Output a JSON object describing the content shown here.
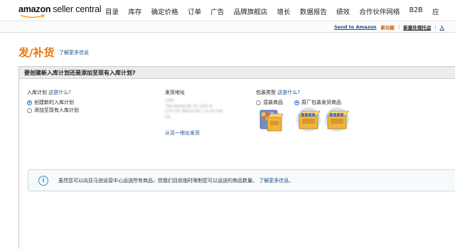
{
  "header": {
    "logo_word1": "amazon",
    "logo_word2": "seller central",
    "nav": [
      "目录",
      "库存",
      "确定价格",
      "订单",
      "广告",
      "品牌旗舰店",
      "增长",
      "数据报告",
      "绩效",
      "合作伙伴网络",
      "B2B",
      "应"
    ]
  },
  "subbar": {
    "send_to_amazon": "Send to Amazon",
    "help": "新功能",
    "separator": "|",
    "new_shipment": "新建处理托运",
    "trailing": "入"
  },
  "page": {
    "title": "发/补货",
    "learn_more": "了解更多信息"
  },
  "panel": {
    "question": "要创建新入库计划还是添加至现有入库计划?",
    "plan": {
      "label": "入库计划",
      "what": "这是什么?",
      "options": [
        {
          "label": "创建新的入库计划",
          "selected": true
        },
        {
          "label": "添加至现有入库计划",
          "selected": false
        }
      ]
    },
    "address": {
      "label": "发货地址",
      "lines": [
        "CHN",
        "789 NOVALEE ST UNIT B",
        "CITY OF INDUSTRY, CA 91748",
        "US"
      ],
      "ship_from_other": "从另一地址发货"
    },
    "packing": {
      "label": "包装类型",
      "what": "这是什么?",
      "options": [
        {
          "label": "混装商品",
          "selected": false,
          "icon": "mixed-cases-icon"
        },
        {
          "label": "原厂包装发货商品",
          "selected": true,
          "icon": "case-packed-icon"
        }
      ]
    },
    "info": {
      "icon": "i",
      "text": "虽然您可以向亚马逊运营中心运送所有商品，但我们目前临时限制您可以运送的商品数量。",
      "link": "了解更多信息。"
    }
  },
  "colors": {
    "accent_orange": "#e47911",
    "link_blue": "#1a4e8c",
    "radio_blue": "#2a6cc4"
  }
}
